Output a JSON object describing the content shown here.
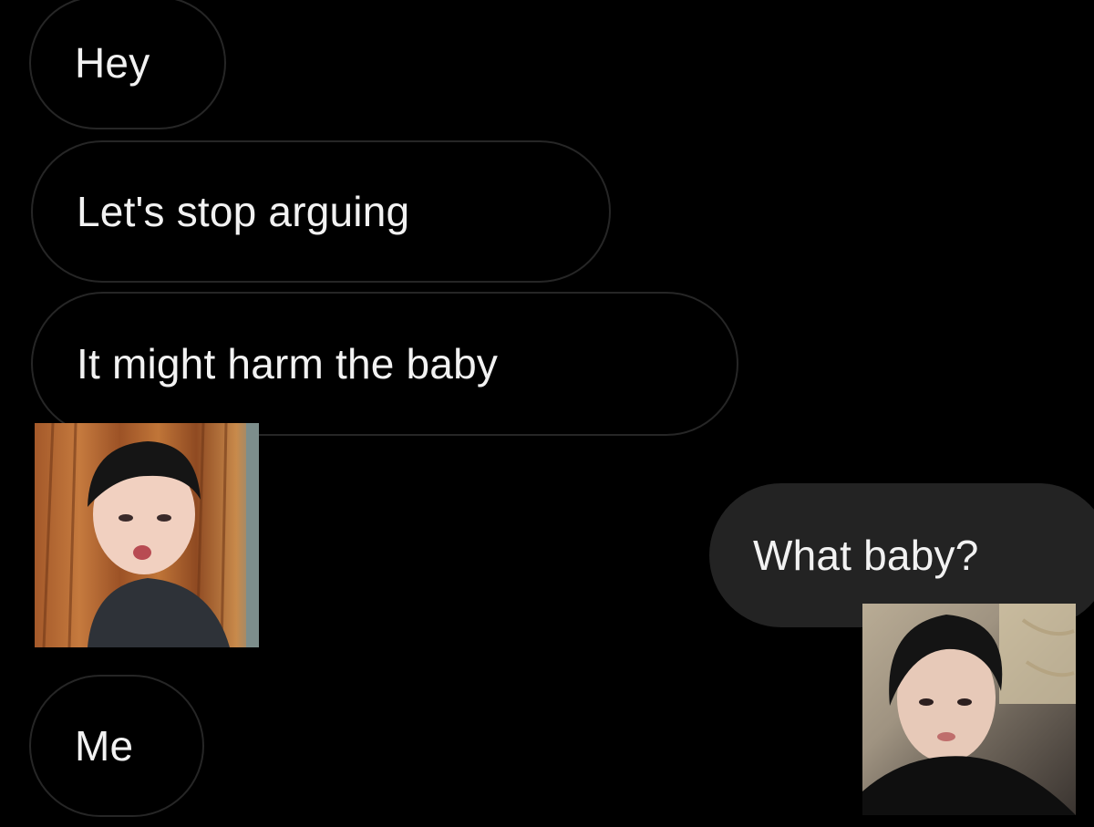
{
  "conversation": {
    "messages": [
      {
        "side": "received",
        "text": "Hey"
      },
      {
        "side": "received",
        "text": "Let's stop arguing"
      },
      {
        "side": "received",
        "text": "It might harm the baby"
      },
      {
        "side": "sent",
        "text": "What baby?"
      },
      {
        "side": "received",
        "text": "Me"
      }
    ]
  },
  "photos": {
    "left": {
      "icon": "person-selfie-photo"
    },
    "right": {
      "icon": "person-selfie-photo"
    }
  },
  "colors": {
    "background": "#000000",
    "received_bubble_border": "#262626",
    "sent_bubble": "#232323",
    "text": "#f2f2f2"
  }
}
